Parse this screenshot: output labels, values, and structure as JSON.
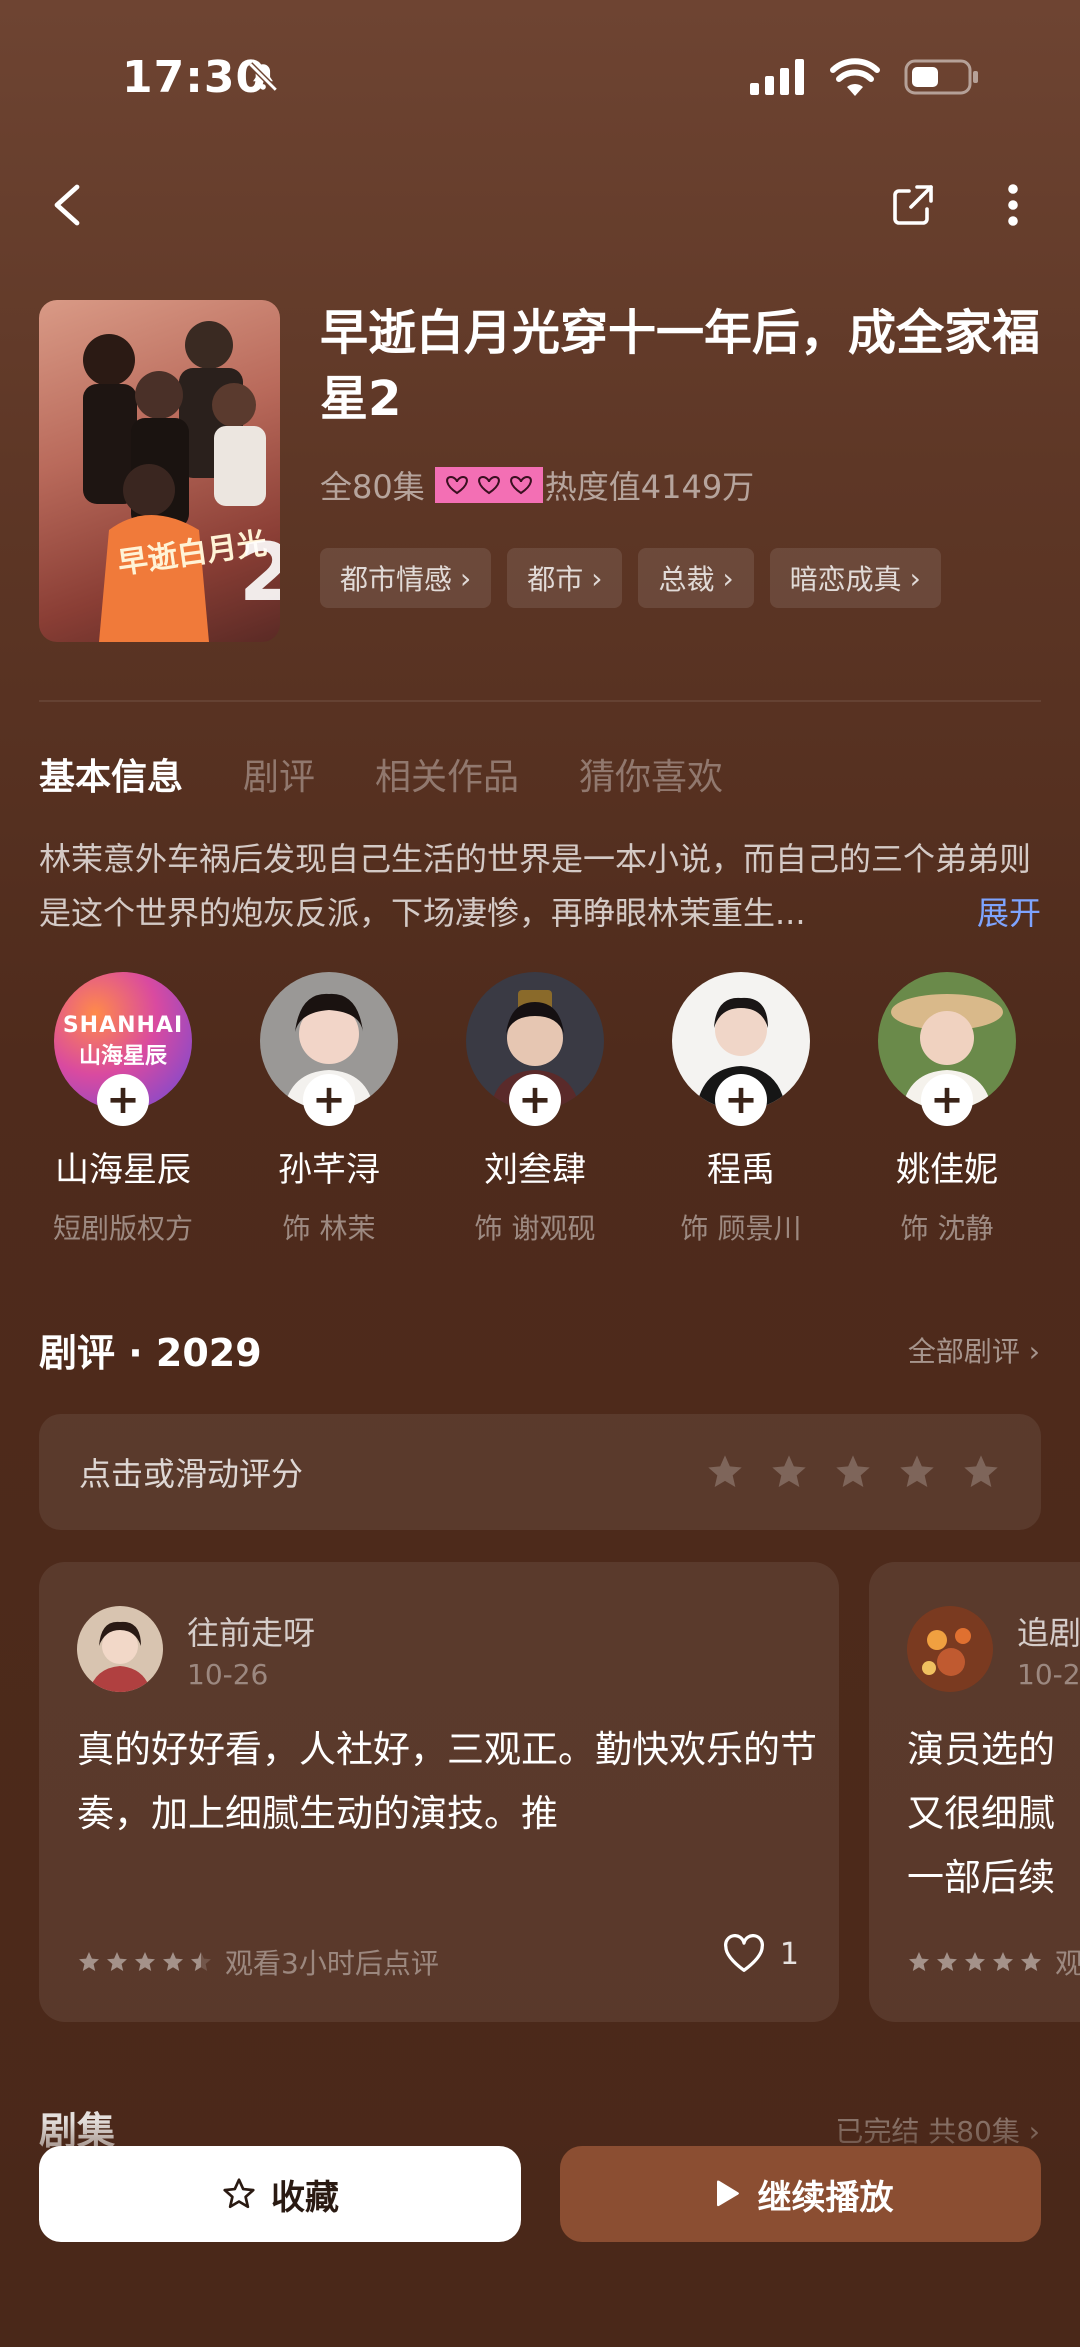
{
  "status": {
    "time": "17:30"
  },
  "show": {
    "title": "早逝白月光穿十一年后，成全家福星2",
    "episodes_label": "全80集",
    "heat_label": "热度值4149万",
    "tags": [
      {
        "label": "都市情感"
      },
      {
        "label": "都市"
      },
      {
        "label": "总裁"
      },
      {
        "label": "暗恋成真"
      }
    ]
  },
  "tabs": [
    {
      "label": "基本信息"
    },
    {
      "label": "剧评"
    },
    {
      "label": "相关作品"
    },
    {
      "label": "猜你喜欢"
    }
  ],
  "synopsis": {
    "text": "林茉意外车祸后发现自己生活的世界是一本小说，而自己的三个弟弟则是这个世界的炮灰反派，下场凄惨，再睁眼林茉重生...",
    "expand": "展开"
  },
  "cast": [
    {
      "name": "山海星辰",
      "role": "短剧版权方",
      "logo_top": "SHANHAI",
      "logo_bottom": "山海星辰"
    },
    {
      "name": "孙芊浔",
      "role": "饰 林茉"
    },
    {
      "name": "刘叁肆",
      "role": "饰 谢观砚"
    },
    {
      "name": "程禹",
      "role": "饰 顾景川"
    },
    {
      "name": "姚佳妮",
      "role": "饰 沈静"
    }
  ],
  "reviews_section": {
    "title": "剧评 · 2029",
    "all_link": "全部剧评 ›",
    "rate_prompt": "点击或滑动评分",
    "cards": [
      {
        "user": "往前走呀",
        "date": "10-26",
        "text": "真的好好看，人社好，三观正。勤快欢乐的节奏，加上细腻生动的演技。推",
        "rating": 4.5,
        "note": "观看3小时后点评",
        "likes": "1"
      },
      {
        "user": "追剧",
        "date": "10-2",
        "text": "演员选的\n又很细腻\n一部后续",
        "rating": 5,
        "note": "观"
      }
    ]
  },
  "episodes_section": {
    "title": "剧集",
    "status": "已完结 共80集 ›"
  },
  "actions": {
    "collect": "收藏",
    "play": "继续播放"
  },
  "colors": {
    "accent_button": "#8b4e32",
    "link_blue": "#7ea4ff",
    "sticker_pink": "#f36fb4"
  }
}
